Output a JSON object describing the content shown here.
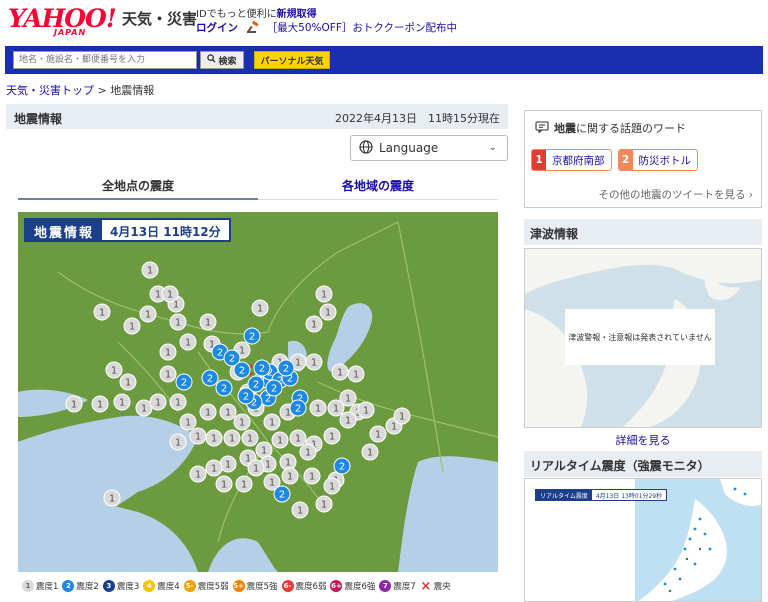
{
  "header": {
    "logo": "YAHOO!",
    "logo_sub": "JAPAN",
    "service": "天気・災害",
    "promo_line1_prefix": "IDでもっと便利に",
    "promo_line1_link": "新規取得",
    "login": "ログイン",
    "promo_line2": "［最大50%OFF］おトククーポン配布中"
  },
  "search": {
    "placeholder": "地名・施設名・郵便番号を入力",
    "button": "検索",
    "personal": "パーソナル天気"
  },
  "breadcrumb": {
    "top": "天気・災害トップ",
    "sep": " > ",
    "current": "地震情報"
  },
  "main": {
    "title": "地震情報",
    "time": "2022年4月13日　11時15分現在",
    "language": "Language",
    "tabs": [
      {
        "label": "全地点の震度"
      },
      {
        "label": "各地域の震度"
      }
    ],
    "map_label_1": "地震情報",
    "map_label_2": "4月13日 11時12分"
  },
  "legend": [
    {
      "num": "1",
      "label": "震度1",
      "color": "#d9d9d9",
      "text": "#666"
    },
    {
      "num": "2",
      "label": "震度2",
      "color": "#1e88e5",
      "text": "#fff"
    },
    {
      "num": "3",
      "label": "震度3",
      "color": "#1b3f8a",
      "text": "#fff"
    },
    {
      "num": "4",
      "label": "震度4",
      "color": "#f5c400",
      "text": "#fff"
    },
    {
      "num": "5-",
      "label": "震度5弱",
      "color": "#f5a000",
      "text": "#fff"
    },
    {
      "num": "5+",
      "label": "震度5強",
      "color": "#f08000",
      "text": "#fff"
    },
    {
      "num": "6-",
      "label": "震度6弱",
      "color": "#e53935",
      "text": "#fff"
    },
    {
      "num": "6+",
      "label": "震度6強",
      "color": "#c2185b",
      "text": "#fff"
    },
    {
      "num": "7",
      "label": "震度7",
      "color": "#8e24aa",
      "text": "#fff"
    },
    {
      "num": "×",
      "label": "震央",
      "color": "transparent",
      "text": "#e53935"
    }
  ],
  "words": {
    "title_prefix": "地震",
    "title_suffix": "に関する話題のワード",
    "items": [
      {
        "rank": "1",
        "label": "京都府南部",
        "color": "#e53935"
      },
      {
        "rank": "2",
        "label": "防災ボトル",
        "color": "#f08a5d"
      }
    ],
    "more": "その他の地震のツイートを見る"
  },
  "tsunami": {
    "title": "津波情報",
    "message": "津波警報・注意報は発表されていません",
    "detail": "詳細を見る"
  },
  "realtime": {
    "title": "リアルタイム震度（強震モニタ）",
    "label_a": "リアルタイム震度",
    "label_b": "4月13日 13時01分29秒"
  },
  "colors": {
    "land": "#6b9b3e",
    "sea": "#b5d0e6",
    "accent": "#1a2eb0"
  }
}
